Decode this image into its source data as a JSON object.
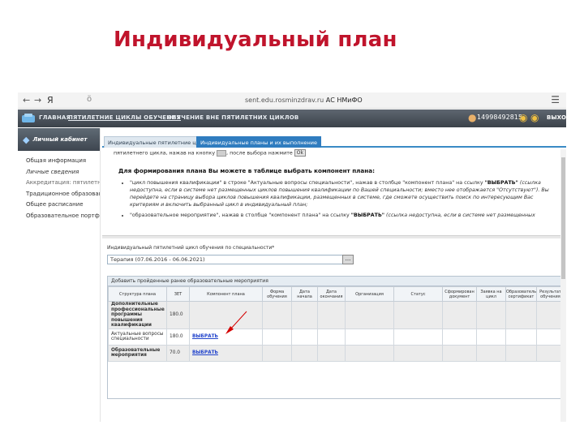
{
  "slide_title": "Индивидуальный план",
  "browser": {
    "back": "←",
    "forward": "→",
    "brand": "Я",
    "lock": "ö",
    "url_host": "sent.edu.rosminzdrav.ru",
    "url_title": "АС НМиФО",
    "menu": "☰"
  },
  "site_header": {
    "tabs": [
      "ГЛАВНАЯ",
      "ПЯТИЛЕТНИЕ ЦИКЛЫ ОБУЧЕНИЯ",
      "ОБУЧЕНИЕ ВНЕ ПЯТИЛЕТНИХ ЦИКЛОВ"
    ],
    "user_id": "14998492815",
    "exit": "ВЫХОД",
    "colors": {
      "header": "#3b424a",
      "accent": "#2f7cbf"
    }
  },
  "sidebar": {
    "title": "Личный кабинет",
    "items": [
      "Общая информация",
      "Личные сведения",
      "Аккредитация: пятилетние циклы",
      "Традиционное образование",
      "Общее расписание",
      "Образовательное портфолио"
    ]
  },
  "content_tabs": [
    "Индивидуальные пятилетние циклы",
    "Индивидуальные планы и их выполнение"
  ],
  "info": {
    "line1_before": "пятилетнего цикла, нажав на кнопку",
    "line1_after": ", после выбора нажмите",
    "ok_label": "Ok",
    "subhead": "Для формирования плана Вы можете в таблице выбрать компонент плана:",
    "bullet1_a": "\"цикл повышения квалификации\" в строке \"Актуальные вопросы специальности\", нажав в столбце \"компонент плана\" на ссылку",
    "bullet1_link": "\"ВЫБРАТЬ\"",
    "bullet1_b": "(ссылка недоступна, если в системе нет размещенных циклов повышения квалификации по Вашей специальности; вместо нее отображается \"Отсутствуют\"). Вы перейдете на страницу выбора циклов повышения квалификации, размещенных в системе, где сможете осуществить поиск по интересующим Вас критериям и включить выбранный цикл в индивидуальный план;",
    "bullet2_a": "\"образовательное мероприятие\", нажав в столбце \"компонент плана\" на ссылку",
    "bullet2_link": "\"ВЫБРАТЬ\"",
    "bullet2_b": "(ссылка недоступна, если в системе нет размещенных"
  },
  "cycle": {
    "label": "Индивидуальный пятилетний цикл обучения по специальности*",
    "value": "Терапия (07.06.2016 - 06.06.2021)",
    "picker": "..."
  },
  "grid": {
    "title": "Добавить пройденные ранее образовательные мероприятия",
    "columns": [
      "Структура плана",
      "ЗЕТ",
      "Компонент плана",
      "Форма обучения",
      "Дата начала",
      "Дата окончания",
      "Организация",
      "Статус",
      "Сформирован документ",
      "Заявка на цикл",
      "Образовательный сертификат",
      "Результат обучения"
    ],
    "rows": [
      {
        "structure": "Дополнительные профессиональные программы повышения квалификации",
        "zet": "180.0",
        "component": "",
        "group": true
      },
      {
        "structure": "Актуальные вопросы специальности",
        "zet": "180.0",
        "component": "ВЫБРАТЬ",
        "group": false
      },
      {
        "structure": "Образовательные мероприятия",
        "zet": "70.0",
        "component": "ВЫБРАТЬ",
        "group": true
      }
    ]
  }
}
